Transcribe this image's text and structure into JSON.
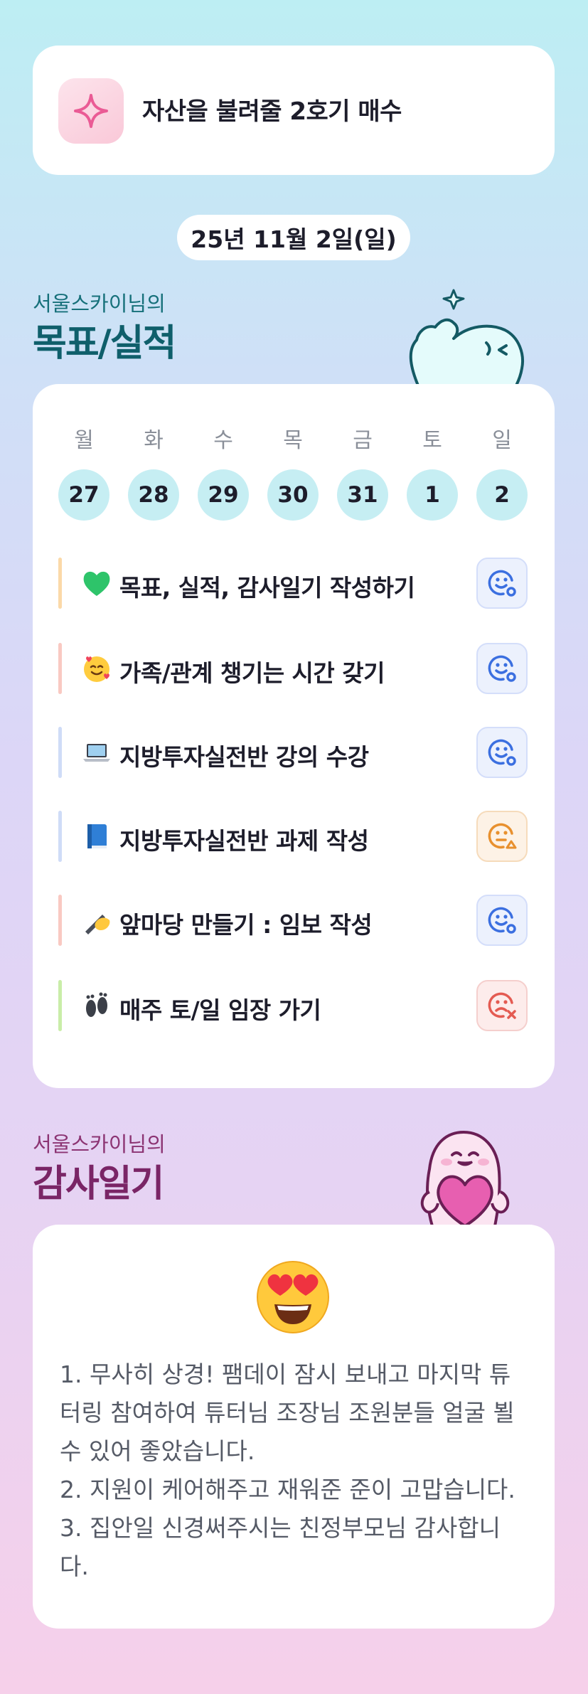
{
  "goal": {
    "title": "자산을 불려줄 2호기 매수",
    "icon": "sparkle-icon"
  },
  "date": "25년 11월 2일(일)",
  "goals_section": {
    "subtitle": "서울스카이님의",
    "title": "목표/실적"
  },
  "week": {
    "weekdays": [
      "월",
      "화",
      "수",
      "목",
      "금",
      "토",
      "일"
    ],
    "days": [
      "27",
      "28",
      "29",
      "30",
      "31",
      "1",
      "2"
    ]
  },
  "tasks": [
    {
      "emoji": "green-heart",
      "label": "목표, 실적, 감사일기 작성하기",
      "status": "done",
      "bar_color": "#fbd9a8"
    },
    {
      "emoji": "smiling-face-with-hearts",
      "label": "가족/관계 챙기는 시간 갖기",
      "status": "done",
      "bar_color": "#f9c9c2"
    },
    {
      "emoji": "laptop",
      "label": "지방투자실전반 강의 수강",
      "status": "done",
      "bar_color": "#cfdcf7"
    },
    {
      "emoji": "blue-book",
      "label": "지방투자실전반 과제 작성",
      "status": "partial",
      "bar_color": "#cfdcf7"
    },
    {
      "emoji": "writing-hand",
      "label": "앞마당 만들기 : 임보 작성",
      "status": "done",
      "bar_color": "#f9c9c2"
    },
    {
      "emoji": "footprints",
      "label": "매주 토/일 임장 가기",
      "status": "fail",
      "bar_color": "#c9eda8"
    }
  ],
  "diary_section": {
    "subtitle": "서울스카이님의",
    "title": "감사일기"
  },
  "diary": {
    "emoji": "heart-eyes",
    "lines": [
      "1. 무사히 상경! 팸데이 잠시 보내고 마지막 튜터링 참여하여 튜터님 조장님 조원분들 얼굴 뵐 수 있어 좋았습니다.",
      "2. 지원이 케어해주고 재워준 준이 고맙습니다.",
      "3. 집안일 신경써주시는 친정부모님 감사합니다."
    ]
  },
  "colors": {
    "done": "#3b6fe0",
    "partial": "#e8902e",
    "fail": "#e45b52"
  }
}
